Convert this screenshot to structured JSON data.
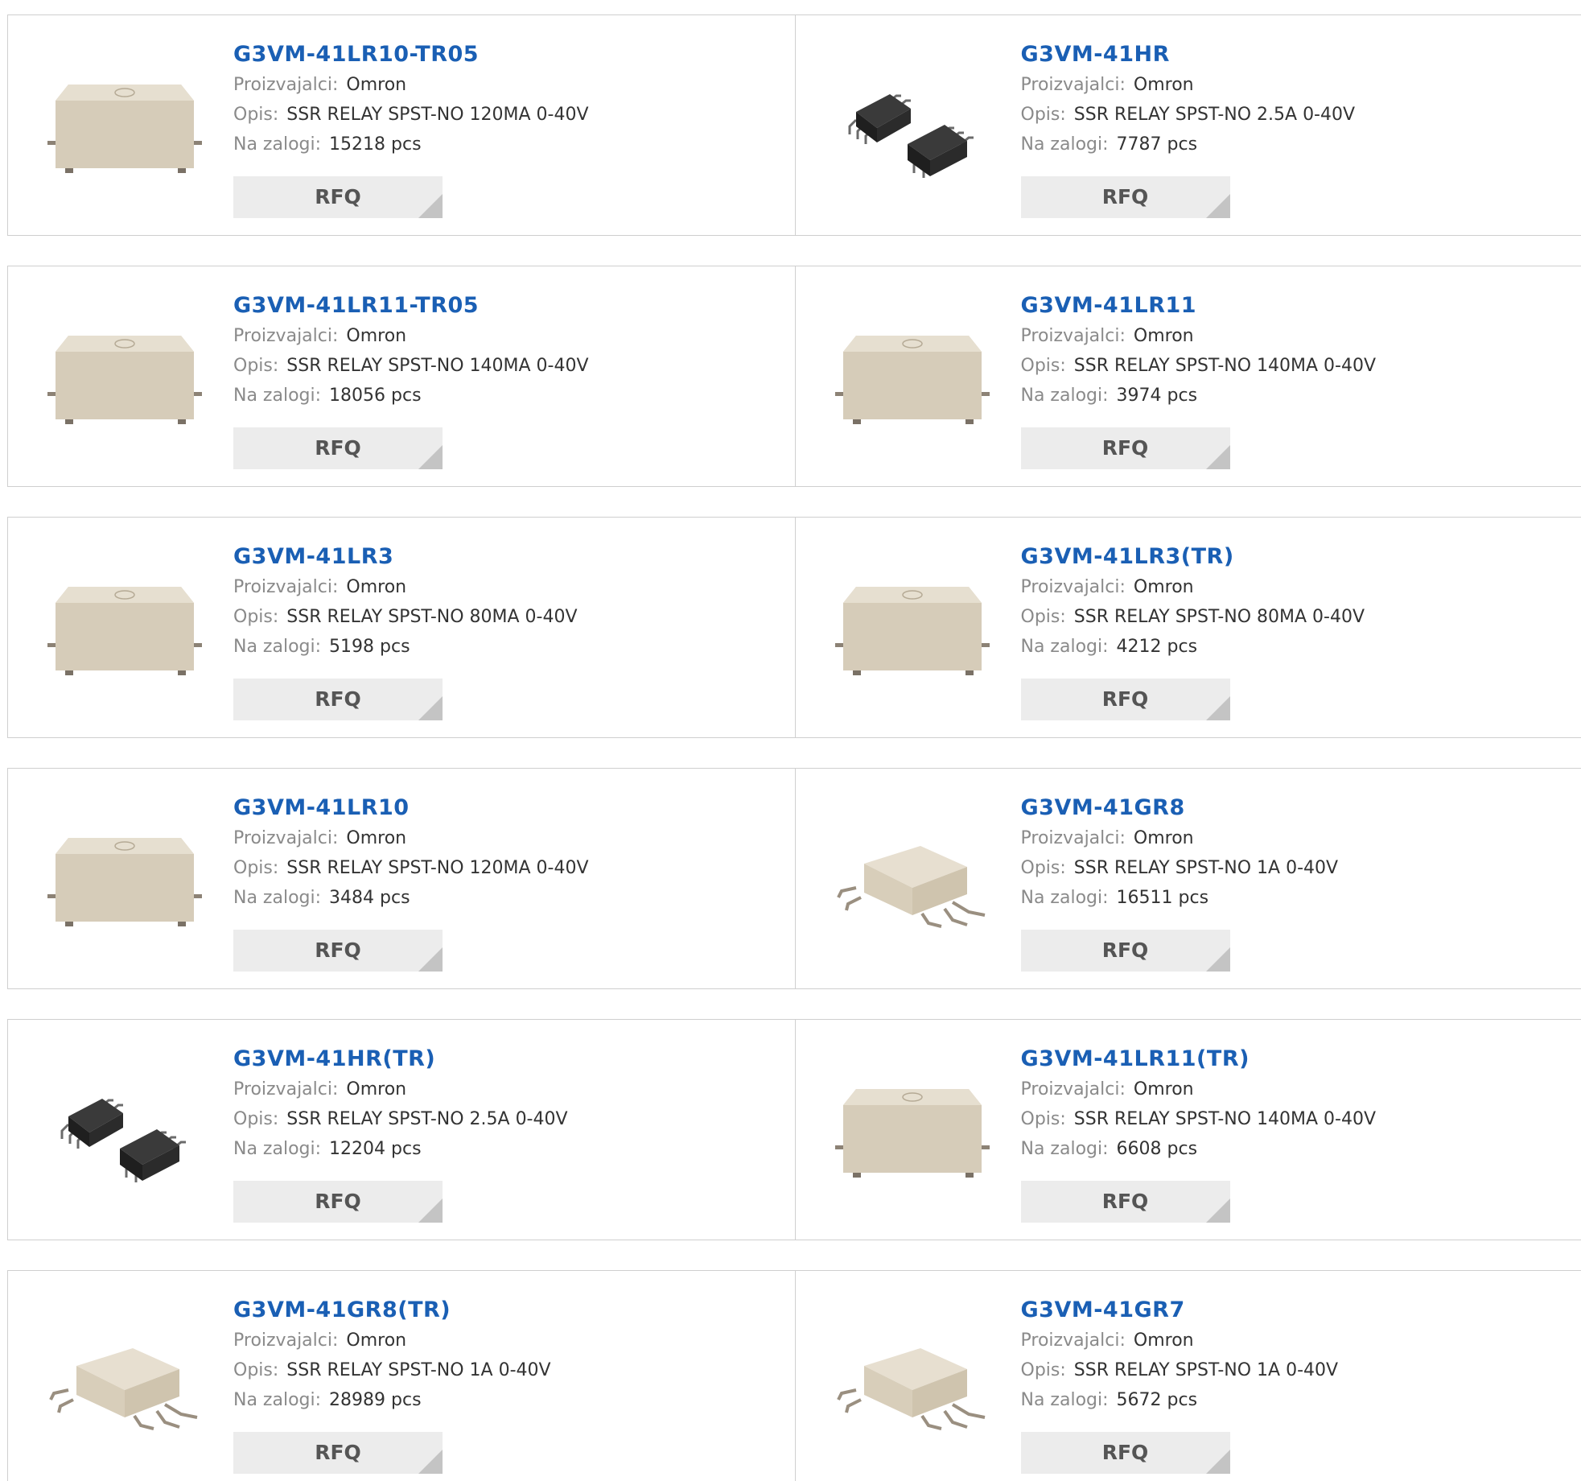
{
  "labels": {
    "manufacturer": "Proizvajalci:",
    "description": "Opis:",
    "stock": "Na zalogi:",
    "rfq": "RFQ"
  },
  "rows": [
    {
      "cards": [
        {
          "part": "G3VM-41LR10-TR05",
          "manufacturer": "Omron",
          "description": "SSR RELAY SPST-NO 120MA 0-40V",
          "stock": "15218 pcs",
          "image": "beige-block-relay-icon"
        },
        {
          "part": "G3VM-41HR",
          "manufacturer": "Omron",
          "description": "SSR RELAY SPST-NO 2.5A 0-40V",
          "stock": "7787 pcs",
          "image": "black-sop-relay-icon"
        }
      ]
    },
    {
      "cards": [
        {
          "part": "G3VM-41LR11-TR05",
          "manufacturer": "Omron",
          "description": "SSR RELAY SPST-NO 140MA 0-40V",
          "stock": "18056 pcs",
          "image": "beige-block-relay-icon"
        },
        {
          "part": "G3VM-41LR11",
          "manufacturer": "Omron",
          "description": "SSR RELAY SPST-NO 140MA 0-40V",
          "stock": "3974 pcs",
          "image": "beige-block-relay-icon"
        }
      ]
    },
    {
      "cards": [
        {
          "part": "G3VM-41LR3",
          "manufacturer": "Omron",
          "description": "SSR RELAY SPST-NO 80MA 0-40V",
          "stock": "5198 pcs",
          "image": "beige-block-relay-icon"
        },
        {
          "part": "G3VM-41LR3(TR)",
          "manufacturer": "Omron",
          "description": "SSR RELAY SPST-NO 80MA 0-40V",
          "stock": "4212 pcs",
          "image": "beige-block-relay-icon"
        }
      ]
    },
    {
      "cards": [
        {
          "part": "G3VM-41LR10",
          "manufacturer": "Omron",
          "description": "SSR RELAY SPST-NO 120MA 0-40V",
          "stock": "3484 pcs",
          "image": "beige-block-relay-icon"
        },
        {
          "part": "G3VM-41GR8",
          "manufacturer": "Omron",
          "description": "SSR RELAY SPST-NO 1A 0-40V",
          "stock": "16511 pcs",
          "image": "beige-gullwing-relay-icon"
        }
      ]
    },
    {
      "cards": [
        {
          "part": "G3VM-41HR(TR)",
          "manufacturer": "Omron",
          "description": "SSR RELAY SPST-NO 2.5A 0-40V",
          "stock": "12204 pcs",
          "image": "black-sop-relay-icon"
        },
        {
          "part": "G3VM-41LR11(TR)",
          "manufacturer": "Omron",
          "description": "SSR RELAY SPST-NO 140MA 0-40V",
          "stock": "6608 pcs",
          "image": "beige-block-relay-icon"
        }
      ]
    },
    {
      "cards": [
        {
          "part": "G3VM-41GR8(TR)",
          "manufacturer": "Omron",
          "description": "SSR RELAY SPST-NO 1A 0-40V",
          "stock": "28989 pcs",
          "image": "beige-gullwing-relay-icon"
        },
        {
          "part": "G3VM-41GR7",
          "manufacturer": "Omron",
          "description": "SSR RELAY SPST-NO 1A 0-40V",
          "stock": "5672 pcs",
          "image": "beige-gullwing-relay-icon"
        }
      ]
    }
  ]
}
